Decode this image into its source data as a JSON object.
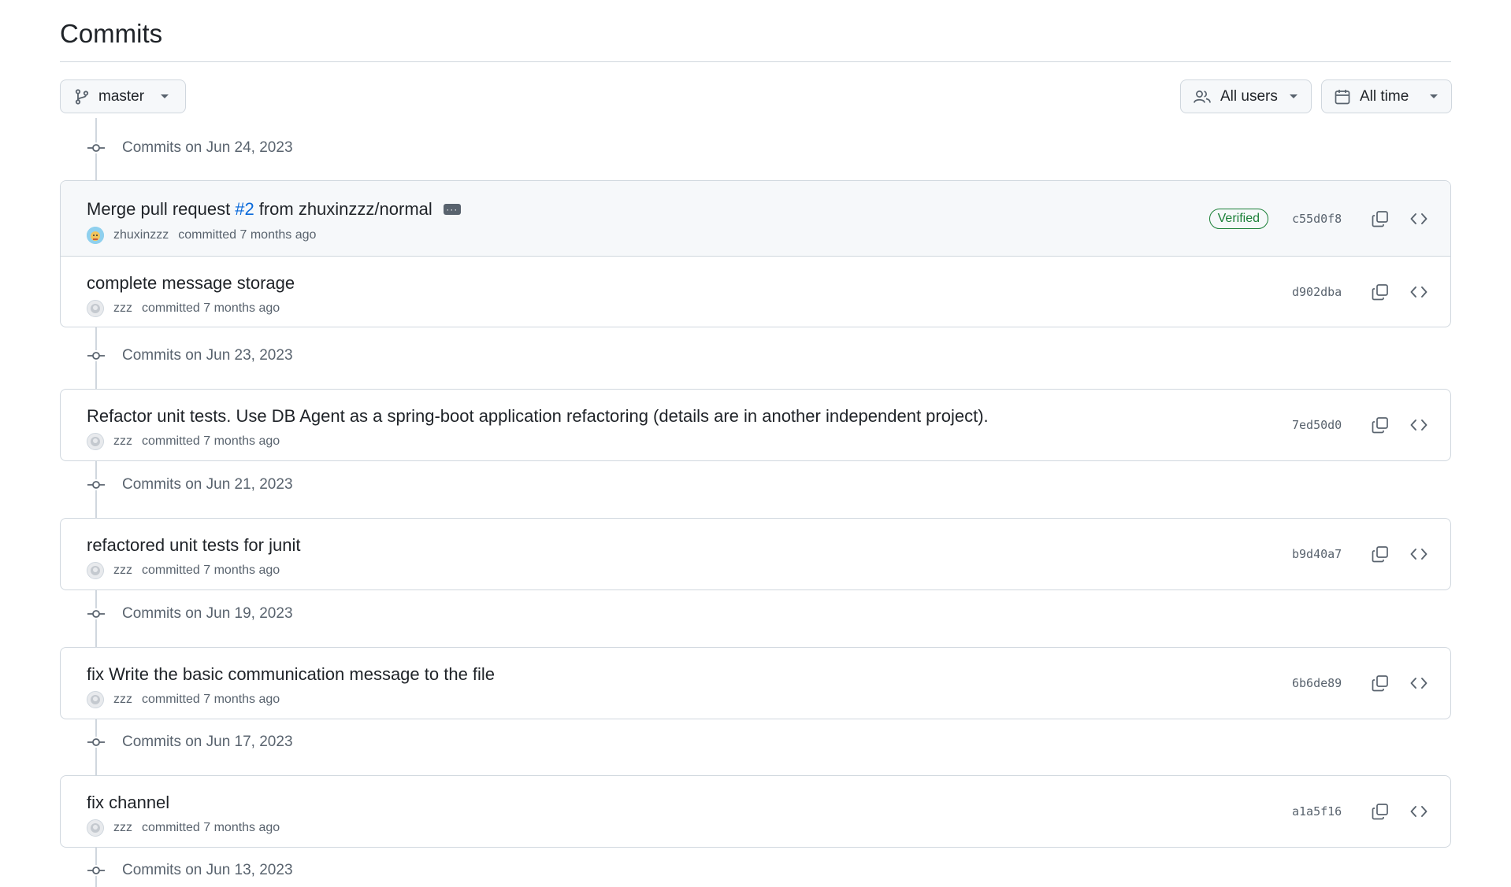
{
  "page": {
    "title": "Commits"
  },
  "filters": {
    "branch": "master",
    "users": "All users",
    "time": "All time"
  },
  "days": [
    {
      "header": "Commits on Jun 24, 2023",
      "commits": [
        {
          "message_prefix": "Merge pull request",
          "pr": "#2",
          "message_suffix": "from zhuxinzzz/normal",
          "author": "zhuxinzzz",
          "action": "committed 7 months ago",
          "verified": "Verified",
          "sha": "c55d0f8"
        },
        {
          "message": "complete message storage",
          "author": "zzz",
          "action": "committed 7 months ago",
          "sha": "d902dba"
        }
      ]
    },
    {
      "header": "Commits on Jun 23, 2023",
      "commits": [
        {
          "message": "Refactor unit tests. Use DB Agent as a spring-boot application refactoring (details are in another independent project).",
          "author": "zzz",
          "action": "committed 7 months ago",
          "sha": "7ed50d0"
        }
      ]
    },
    {
      "header": "Commits on Jun 21, 2023",
      "commits": [
        {
          "message": "refactored unit tests for junit",
          "author": "zzz",
          "action": "committed 7 months ago",
          "sha": "b9d40a7"
        }
      ]
    },
    {
      "header": "Commits on Jun 19, 2023",
      "commits": [
        {
          "message": "fix Write the basic communication message to the file",
          "author": "zzz",
          "action": "committed 7 months ago",
          "sha": "6b6de89"
        }
      ]
    },
    {
      "header": "Commits on Jun 17, 2023",
      "commits": [
        {
          "message": "fix channel",
          "author": "zzz",
          "action": "committed 7 months ago",
          "sha": "a1a5f16"
        }
      ]
    },
    {
      "header": "Commits on Jun 13, 2023",
      "commits": []
    }
  ],
  "colors": {
    "link": "#0969da",
    "verified": "#1a7f37",
    "border": "#d0d7de",
    "muted": "#59636e"
  }
}
